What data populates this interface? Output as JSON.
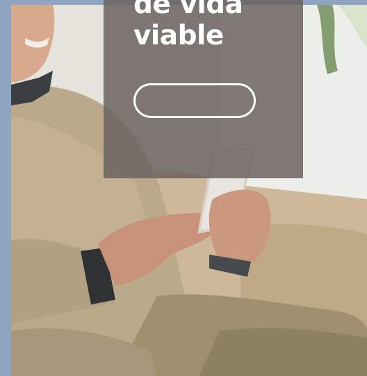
{
  "hero": {
    "headline_lines": [
      "de vida",
      "viable"
    ],
    "cta_label": ""
  },
  "colors": {
    "page_background": "#8fa4c0",
    "overlay": "#6c6461",
    "headline_text": "#ffffff",
    "button_border": "#ffffff"
  }
}
